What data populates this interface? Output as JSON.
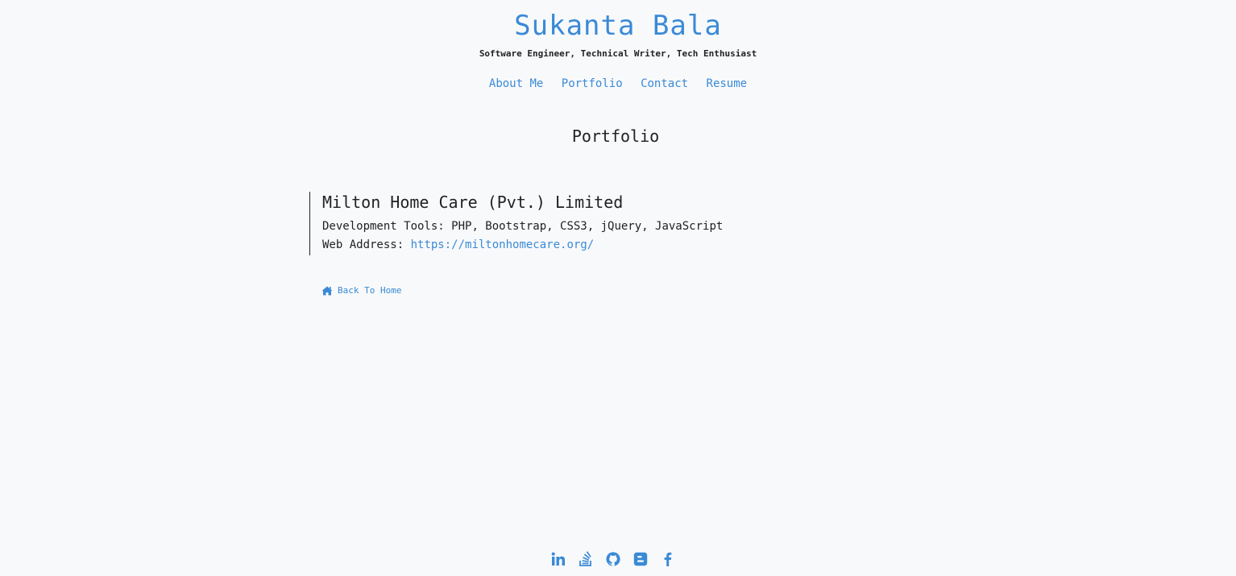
{
  "header": {
    "site_title": "Sukanta Bala",
    "tagline": "Software Engineer, Technical Writer, Tech Enthusiast"
  },
  "nav": {
    "items": [
      "About Me",
      "Portfolio",
      "Contact",
      "Resume"
    ]
  },
  "main": {
    "section_title": "Portfolio",
    "project": {
      "name": "Milton Home Care (Pvt.) Limited",
      "tools_label": "Development Tools:",
      "tools": "PHP, Bootstrap, CSS3, jQuery, JavaScript",
      "web_label": "Web Address:",
      "web_url": "https://miltonhomecare.org/"
    },
    "back_home": "Back To Home"
  },
  "footer": {
    "social_icons": [
      "linkedin-icon",
      "stackoverflow-icon",
      "github-icon",
      "blogger-icon",
      "facebook-icon"
    ]
  },
  "colors": {
    "accent": "#3a8ad6",
    "background": "#f8f9fb",
    "text": "#222222"
  }
}
